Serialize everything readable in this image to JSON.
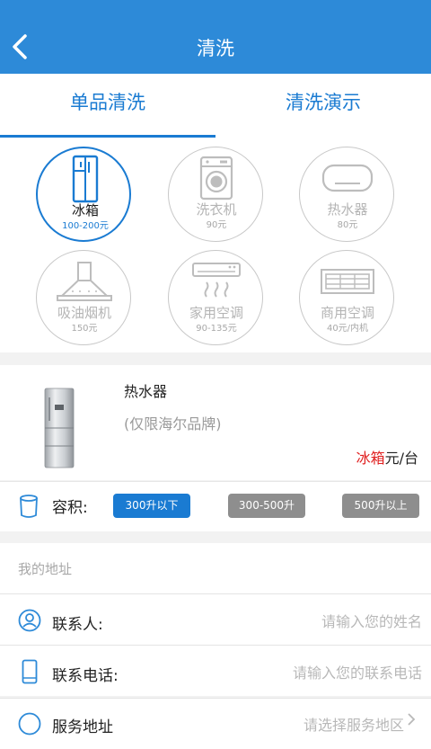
{
  "header": {
    "title": "清洗",
    "back_icon": "chevron-left-icon"
  },
  "tabs": [
    {
      "label": "单品清洗",
      "active": true
    },
    {
      "label": "清洗演示",
      "active": false
    }
  ],
  "categories": [
    {
      "name": "冰箱",
      "price": "100-200元",
      "icon": "fridge-icon",
      "active": true
    },
    {
      "name": "洗衣机",
      "price": "90元",
      "icon": "washing-machine-icon",
      "active": false
    },
    {
      "name": "热水器",
      "price": "80元",
      "icon": "water-heater-icon",
      "active": false
    },
    {
      "name": "吸油烟机",
      "price": "150元",
      "icon": "range-hood-icon",
      "active": false
    },
    {
      "name": "家用空调",
      "price": "90-135元",
      "icon": "air-conditioner-icon",
      "active": false
    },
    {
      "name": "商用空调",
      "price": "40元/内机",
      "icon": "commercial-ac-icon",
      "active": false
    }
  ],
  "product": {
    "name": "热水器",
    "description": "(仅限海尔品牌)",
    "unit_highlight": "冰箱",
    "unit_suffix": "元/台"
  },
  "capacity": {
    "label": "容积:",
    "options": [
      {
        "label": "300升以下",
        "selected": true
      },
      {
        "label": "300-500升",
        "selected": false
      },
      {
        "label": "500升以上",
        "selected": false
      }
    ]
  },
  "address": {
    "title": "我的地址",
    "contact_label": "联系人:",
    "contact_placeholder": "请输入您的姓名",
    "phone_label": "联系电话:",
    "phone_placeholder": "请输入您的联系电话",
    "service_label": "服务地址",
    "service_placeholder": "请选择服务地区"
  },
  "colors": {
    "header_bg": "#2d8ad8",
    "accent": "#1a7bd2",
    "selected_option": "#1a7bd2",
    "unselected_option": "#8e8e8e",
    "price_highlight": "#e02020"
  }
}
